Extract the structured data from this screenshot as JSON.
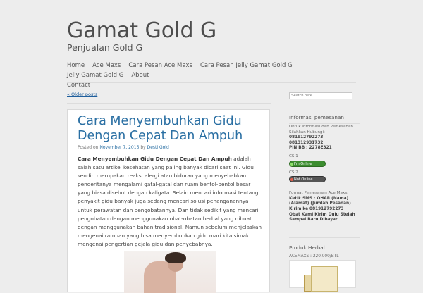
{
  "site": {
    "title": "Gamat Gold G",
    "description": "Penjualan Gold G"
  },
  "nav": {
    "items": [
      "Home",
      "Ace Maxs",
      "Cara Pesan Ace Maxs",
      "Cara Pesan Jelly Gamat Gold G",
      "Jelly Gamat Gold G",
      "About",
      "Contact"
    ]
  },
  "older_posts": "« Older posts",
  "search": {
    "placeholder": "Search here..."
  },
  "post": {
    "title": "Cara Menyembuhkan Gidu Dengan Cepat Dan Ampuh",
    "meta_prefix": "Posted on",
    "date": "November 7, 2015",
    "meta_by": "by",
    "author": "Desti Gold",
    "intro_bold": "Cara Menyembuhkan Gidu Dengan Cepat Dan Ampuh",
    "body": " adalah salah satu artikel kesehatan yang paling banyak dicari saat ini. Gidu sendiri merupakan reaksi alergi atau biduran yang menyebabkan penderitanya mengalami gatal-gatal dan ruam bentol-bentol besar yang biasa disebut dengan kaligata. Selain mencari informasi tentang penyakit gidu banyak juga sedang mencari solusi penanganannya untuk perawatan dan pengobatannya. Dan tidak sedikit yang mencari pengobatan dengan menggunakan obat-obatan herbal yang dibuat dengan menggunakan bahan tradisional. Namun sebelum menjelaskan mengenai ramuan yang bisa menyembuhkan gidu mari kita simak mengenai pengertian gejala gidu dan penyebabnya."
  },
  "sidebar": {
    "info_title": "Informasi pemesanan",
    "info_text1": "Untuk informasi dan Pemesanan",
    "info_text2": "Silahkan Hubungi:",
    "phone1": "081912792273",
    "phone2": "081312931732",
    "pin": "PIN BB : 2278E321",
    "cs1_label": "CS 1 :",
    "cs1_status": "I'm Online",
    "cs2_label": "CS 2 :",
    "cs2_status": "Not Online",
    "format_title": "Format Pemesanan Ace Maxs:",
    "format_line1": "Ketik SMS : OHAR (Nama)",
    "format_line2": "(Alamat) (Jumlah Pesanan)",
    "format_line3": "Kirim ke 081912792273",
    "format_line4": "Obat Kami Kirim Dulu Stelah",
    "format_line5": "Sampai Baru Dibayar",
    "product_title": "Produk Herbal",
    "product_price": "ACEMAXS : 220.000/BTL"
  },
  "colors": {
    "background": "#ededed",
    "link": "#2a6fa3",
    "online": "#3c8d2f",
    "offline": "#555555"
  }
}
